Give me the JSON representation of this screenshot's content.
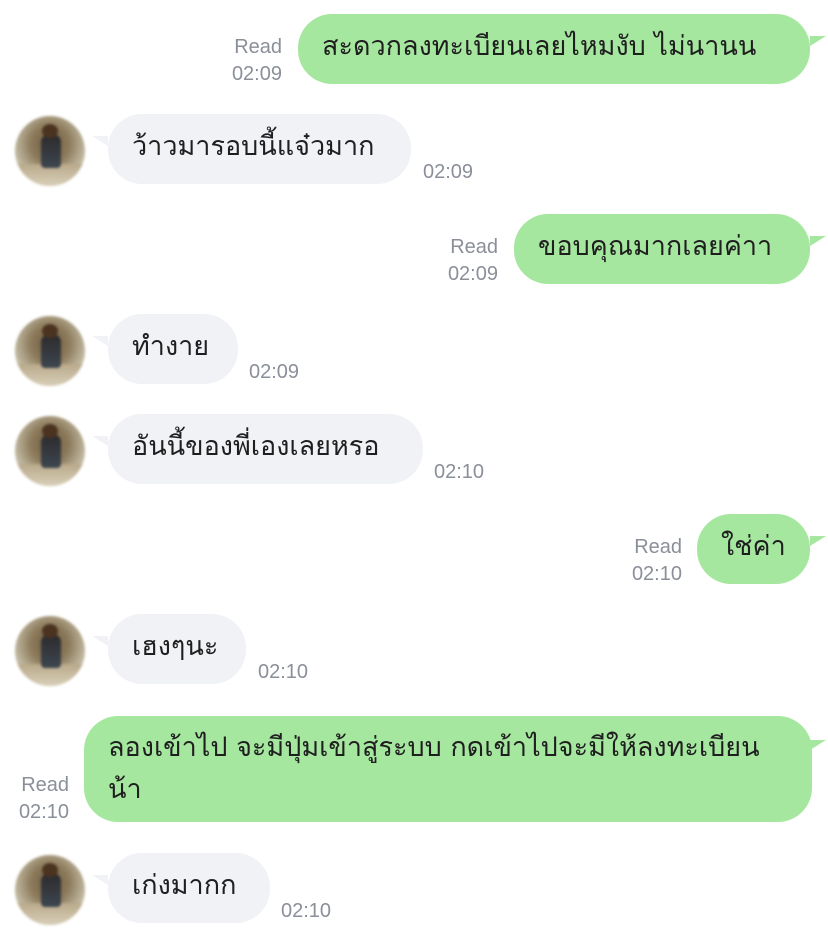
{
  "messages": [
    {
      "dir": "out",
      "text": "สะดวกลงทะเบียนเลยไหมงับ ไม่นานน",
      "status": "Read",
      "time": "02:09"
    },
    {
      "dir": "in",
      "text": "ว้าวมารอบนี้แจ๋วมาก",
      "time": "02:09"
    },
    {
      "dir": "out",
      "text": "ขอบคุณมากเลยค่าา",
      "status": "Read",
      "time": "02:09"
    },
    {
      "dir": "in",
      "text": "ทำงาย",
      "time": "02:09"
    },
    {
      "dir": "in",
      "text": "อันนี้ของพี่เองเลยหรอ",
      "time": "02:10"
    },
    {
      "dir": "out",
      "text": "ใช่ค่า",
      "status": "Read",
      "time": "02:10"
    },
    {
      "dir": "in",
      "text": "เฮงๆนะ",
      "time": "02:10"
    },
    {
      "dir": "out",
      "text": "ลองเข้าไป จะมีปุ่มเข้าสู่ระบบ กดเข้าไปจะมีให้ลงทะเบียนน้า",
      "status": "Read",
      "time": "02:10"
    },
    {
      "dir": "in",
      "text": "เก่งมากก",
      "time": "02:10"
    }
  ]
}
